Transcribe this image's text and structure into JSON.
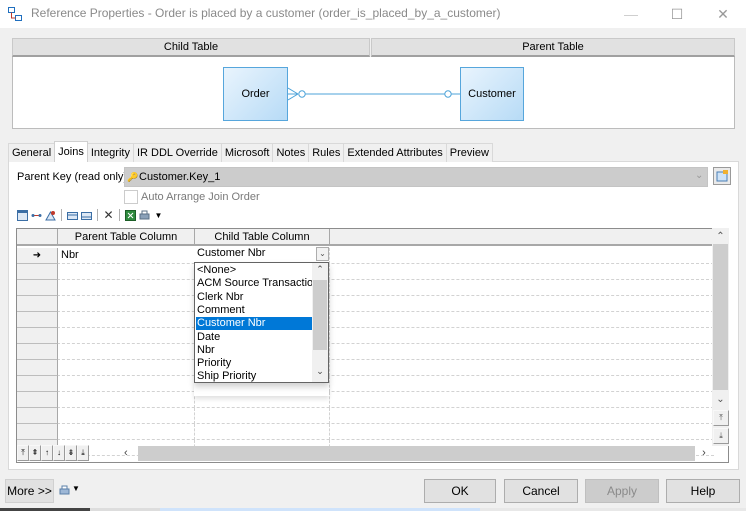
{
  "window": {
    "title": "Reference Properties - Order is placed by a customer (order_is_placed_by_a_customer)",
    "controls": {
      "minimize": "—",
      "maximize": "☐",
      "close": "✕"
    }
  },
  "diagram": {
    "child_header": "Child Table",
    "parent_header": "Parent Table",
    "child_entity": "Order",
    "parent_entity": "Customer",
    "line_color": "#4da3d9"
  },
  "tabs": [
    {
      "label": "General"
    },
    {
      "label": "Joins",
      "active": true
    },
    {
      "label": "Integrity"
    },
    {
      "label": "IR DDL Override"
    },
    {
      "label": "Microsoft"
    },
    {
      "label": "Notes"
    },
    {
      "label": "Rules"
    },
    {
      "label": "Extended Attributes"
    },
    {
      "label": "Preview"
    }
  ],
  "joins": {
    "parent_key_label": "Parent Key (read only):",
    "parent_key_value": "Customer.Key_1",
    "auto_arrange_label": "Auto Arrange Join Order",
    "auto_arrange_checked": false,
    "toolbar_icons": [
      "properties-icon",
      "insert-row-icon",
      "add-columns-icon",
      "move-up-icon",
      "move-down-icon",
      "delete-icon",
      "excel-export-icon",
      "print-icon",
      "more-dropdown-icon"
    ],
    "grid": {
      "columns": [
        "Parent Table Column",
        "Child Table Column"
      ],
      "rows": [
        {
          "marker": "➜",
          "parent": "Nbr",
          "child": "Customer Nbr"
        }
      ],
      "empty_rows": 12
    },
    "dropdown": {
      "current": "Customer Nbr",
      "options": [
        "<None>",
        "ACM Source Transaction",
        "Clerk Nbr",
        "Comment",
        "Customer Nbr",
        "Date",
        "Nbr",
        "Priority",
        "Ship Priority"
      ],
      "selected_index": 4
    },
    "nav_buttons": [
      "⤒",
      "⇞",
      "↑",
      "↓",
      "⇟",
      "⤓"
    ]
  },
  "footer": {
    "more_label": "More >>",
    "ok_label": "OK",
    "cancel_label": "Cancel",
    "apply_label": "Apply",
    "help_label": "Help"
  },
  "colors": {
    "selection": "#0078d7",
    "entity_border": "#56a6dc"
  }
}
